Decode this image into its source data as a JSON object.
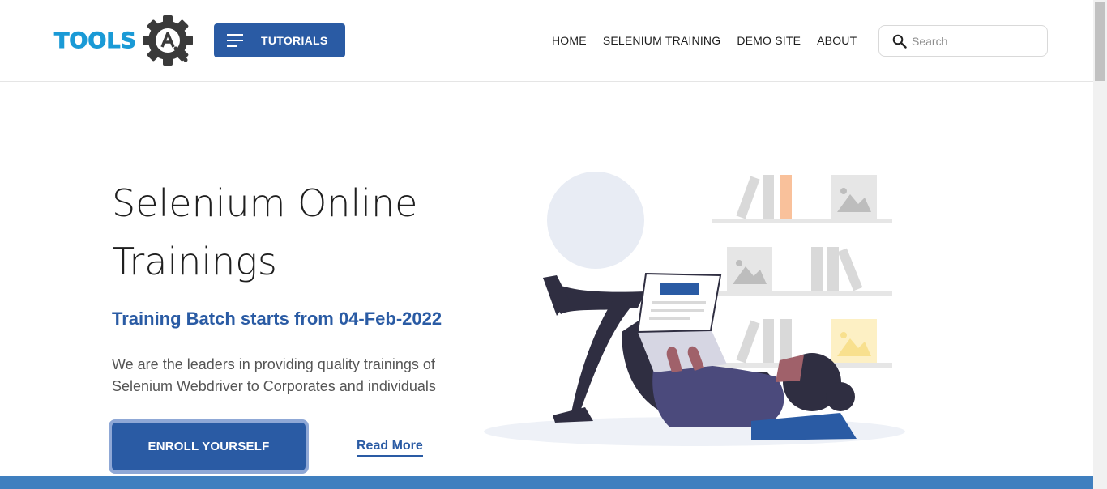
{
  "header": {
    "logo_text": "TOOLS",
    "tutorials_label": "TUTORIALS",
    "nav": [
      {
        "label": "HOME"
      },
      {
        "label": "SELENIUM TRAINING"
      },
      {
        "label": "DEMO SITE"
      },
      {
        "label": "ABOUT"
      }
    ],
    "search": {
      "placeholder": "Search",
      "value": ""
    }
  },
  "hero": {
    "title_line1": "Selenium Online",
    "title_line2": "Trainings",
    "subtitle": "Training Batch starts from 04-Feb-2022",
    "description": "We are the leaders in providing quality trainings of Selenium Webdriver to Corporates and individuals",
    "enroll_label": "ENROLL YOURSELF",
    "read_more_label": "Read More"
  },
  "colors": {
    "brand_blue": "#2a5ba4",
    "logo_blue": "#1a9ad6",
    "band_blue": "#3f7fbf"
  },
  "icons": {
    "menu": "hamburger-icon",
    "search": "search-icon",
    "logo": "gear-icon"
  }
}
